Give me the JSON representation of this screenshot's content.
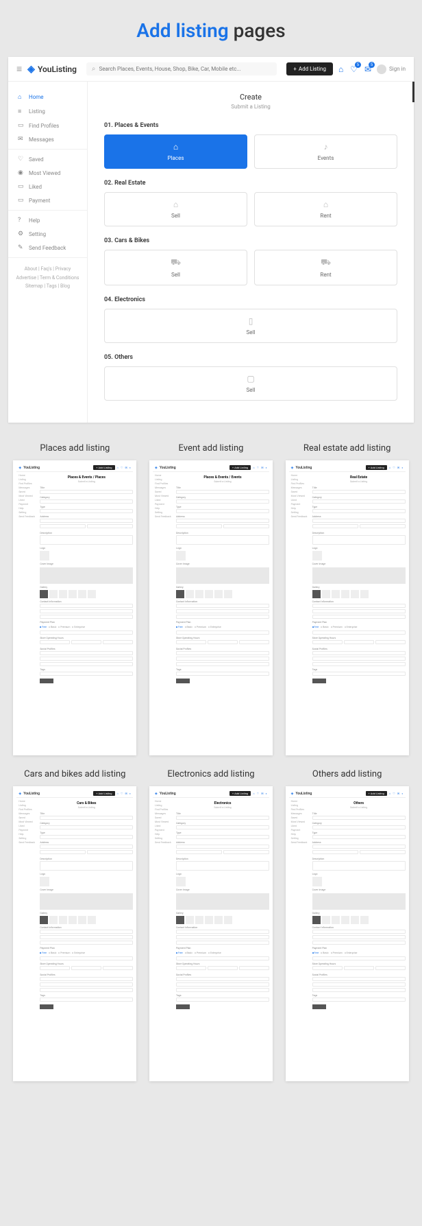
{
  "pageTitle": {
    "accent": "Add listing",
    "rest": " pages"
  },
  "brand": "YouListing",
  "search": {
    "placeholder": "Search Places, Events, House, Shop, Bike, Car, Mobile etc..."
  },
  "addListingBtn": "Add Listing",
  "badges": {
    "b1": "5",
    "b2": "5"
  },
  "signIn": "Sign in",
  "sidebar": {
    "s1": [
      {
        "icon": "⌂",
        "label": "Home"
      },
      {
        "icon": "≡",
        "label": "Listing"
      },
      {
        "icon": "▭",
        "label": "Find Profiles"
      },
      {
        "icon": "✉",
        "label": "Messages"
      }
    ],
    "s2": [
      {
        "icon": "♡",
        "label": "Saved"
      },
      {
        "icon": "◉",
        "label": "Most Viewed"
      },
      {
        "icon": "▭",
        "label": "Liked"
      },
      {
        "icon": "▭",
        "label": "Payment"
      }
    ],
    "s3": [
      {
        "icon": "?",
        "label": "Help"
      },
      {
        "icon": "⚙",
        "label": "Setting"
      },
      {
        "icon": "✎",
        "label": "Send Feedback"
      }
    ],
    "footer": {
      "l1": "About  |  Faq's  |  Privacy",
      "l2": "Advertise  |  Term & Conditions",
      "l3": "Sitemap  |  Tags  |  Blog"
    }
  },
  "create": {
    "title": "Create",
    "subtitle": "Submit a Listing"
  },
  "sections": [
    {
      "label": "01. Places & Events",
      "options": [
        {
          "icon": "⌂",
          "text": "Places",
          "selected": true
        },
        {
          "icon": "♪",
          "text": "Events"
        }
      ]
    },
    {
      "label": "02. Real Estate",
      "options": [
        {
          "icon": "⌂",
          "text": "Sell"
        },
        {
          "icon": "⌂",
          "text": "Rent"
        }
      ]
    },
    {
      "label": "03. Cars & Bikes",
      "options": [
        {
          "icon": "⛟",
          "text": "Sell"
        },
        {
          "icon": "⛟",
          "text": "Rent"
        }
      ]
    },
    {
      "label": "04. Electronics",
      "options": [
        {
          "icon": "▯",
          "text": "Sell"
        }
      ]
    },
    {
      "label": "05. Others",
      "options": [
        {
          "icon": "▢",
          "text": "Sell"
        }
      ]
    }
  ],
  "thumbsRow1": [
    {
      "title": "Places add listing",
      "hdr": "Places & Events / Places"
    },
    {
      "title": "Event add listing",
      "hdr": "Places & Events / Events"
    },
    {
      "title": "Real estate add listing",
      "hdr": "Real Estate"
    }
  ],
  "thumbsRow2": [
    {
      "title": "Cars and bikes add listing",
      "hdr": "Cars & Bikes"
    },
    {
      "title": "Electronics add listing",
      "hdr": "Electronics"
    },
    {
      "title": "Others add listing",
      "hdr": "Others"
    }
  ],
  "thumbCommon": {
    "sideItems": [
      "Home",
      "Listing",
      "Find Profiles",
      "Messages",
      "Saved",
      "Most Viewed",
      "Liked",
      "Payment",
      "Help",
      "Setting",
      "Send Feedback"
    ],
    "subtitle": "Submit a Listing",
    "labels": {
      "title": "Title",
      "category": "Category",
      "type": "Type",
      "address": "Address",
      "desc": "Description",
      "logo": "Logo",
      "cover": "Cover Image",
      "gallery": "Gallery",
      "contact": "Contact Information",
      "plan": "Payment Plan",
      "hours": "Store Operating Hours",
      "social": "Social Profiles",
      "tags": "Tags",
      "submit": "Submit"
    },
    "plans": [
      "Free",
      "Basic",
      "Premium",
      "Enterprise"
    ]
  }
}
